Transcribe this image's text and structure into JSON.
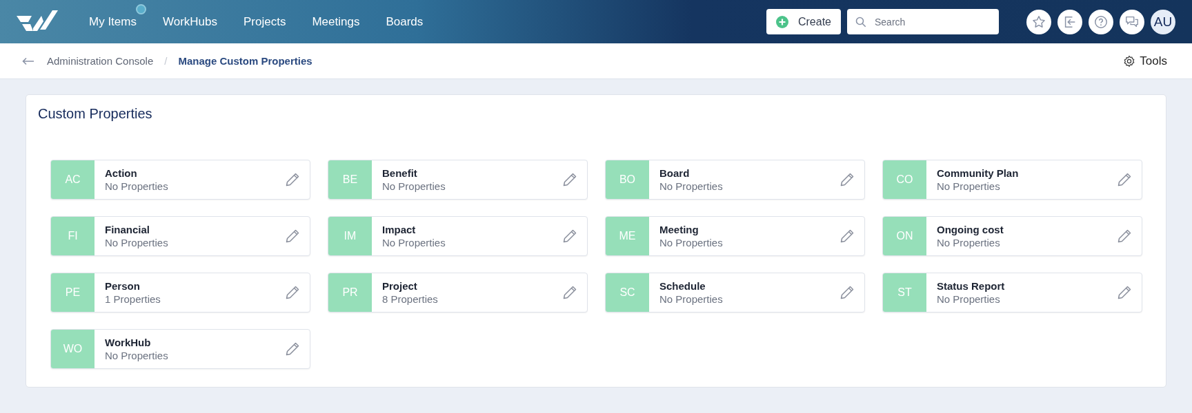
{
  "nav": {
    "items": [
      {
        "label": "My Items",
        "indicator": true
      },
      {
        "label": "WorkHubs",
        "indicator": false
      },
      {
        "label": "Projects",
        "indicator": false
      },
      {
        "label": "Meetings",
        "indicator": false
      },
      {
        "label": "Boards",
        "indicator": false
      }
    ],
    "create_button": "Create",
    "search": {
      "placeholder": "Search"
    },
    "user_initials": "AU"
  },
  "breadcrumb": {
    "items": [
      "Administration Console",
      "Manage Custom Properties"
    ],
    "separator": "/",
    "tools": "Tools"
  },
  "panel": {
    "title": "Custom Properties",
    "tiles": [
      {
        "abbr": "AC",
        "name": "Action",
        "count": "No Properties"
      },
      {
        "abbr": "BE",
        "name": "Benefit",
        "count": "No Properties"
      },
      {
        "abbr": "BO",
        "name": "Board",
        "count": "No Properties"
      },
      {
        "abbr": "CO",
        "name": "Community Plan",
        "count": "No Properties"
      },
      {
        "abbr": "FI",
        "name": "Financial",
        "count": "No Properties"
      },
      {
        "abbr": "IM",
        "name": "Impact",
        "count": "No Properties"
      },
      {
        "abbr": "ME",
        "name": "Meeting",
        "count": "No Properties"
      },
      {
        "abbr": "ON",
        "name": "Ongoing cost",
        "count": "No Properties"
      },
      {
        "abbr": "PE",
        "name": "Person",
        "count": "1 Properties"
      },
      {
        "abbr": "PR",
        "name": "Project",
        "count": "8 Properties"
      },
      {
        "abbr": "SC",
        "name": "Schedule",
        "count": "No Properties"
      },
      {
        "abbr": "ST",
        "name": "Status Report",
        "count": "No Properties"
      },
      {
        "abbr": "WO",
        "name": "WorkHub",
        "count": "No Properties"
      }
    ]
  }
}
